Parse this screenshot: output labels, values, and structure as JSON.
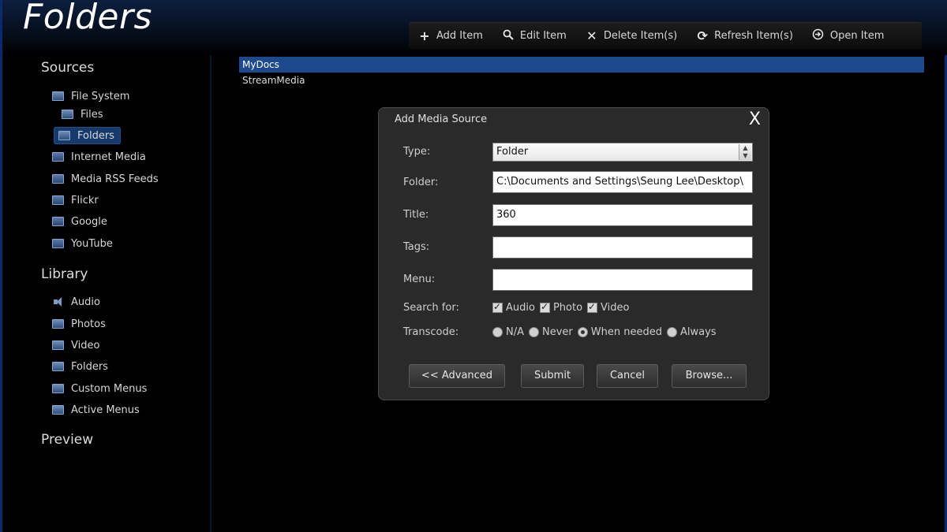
{
  "page": {
    "title": "Folders"
  },
  "toolbar": {
    "add": {
      "icon": "plus-icon",
      "label": "Add Item"
    },
    "edit": {
      "icon": "magnifier-icon",
      "label": "Edit Item"
    },
    "delete": {
      "icon": "x-icon",
      "label": "Delete Item(s)"
    },
    "refresh": {
      "icon": "refresh-icon",
      "label": "Refresh Item(s)"
    },
    "open": {
      "icon": "arrow-circle-icon",
      "label": "Open Item"
    }
  },
  "sidebar": {
    "sources_heading": "Sources",
    "library_heading": "Library",
    "preview_heading": "Preview",
    "sources": [
      {
        "label": "File System"
      },
      {
        "label": "Files"
      },
      {
        "label": "Folders"
      },
      {
        "label": "Internet Media"
      },
      {
        "label": "Media RSS Feeds"
      },
      {
        "label": "Flickr"
      },
      {
        "label": "Google"
      },
      {
        "label": "YouTube"
      }
    ],
    "library": [
      {
        "label": "Audio"
      },
      {
        "label": "Photos"
      },
      {
        "label": "Video"
      },
      {
        "label": "Folders"
      },
      {
        "label": "Custom Menus"
      },
      {
        "label": "Active Menus"
      }
    ]
  },
  "main": {
    "items": [
      {
        "label": "MyDocs",
        "selected": true
      },
      {
        "label": "StreamMedia",
        "selected": false
      }
    ]
  },
  "dialog": {
    "title": "Add Media Source",
    "close_glyph": "X",
    "type_label": "Type:",
    "type_value": "Folder",
    "folder_label": "Folder:",
    "folder_value": "C:\\Documents and Settings\\Seung Lee\\Desktop\\",
    "title_label": "Title:",
    "title_value": "360",
    "tags_label": "Tags:",
    "tags_value": "",
    "menu_label": "Menu:",
    "menu_value": "",
    "search_label": "Search for:",
    "search_options": [
      "Audio",
      "Photo",
      "Video"
    ],
    "transcode_label": "Transcode:",
    "transcode_options": [
      "N/A",
      "Never",
      "When needed",
      "Always"
    ],
    "buttons": {
      "advanced": "<< Advanced",
      "submit": "Submit",
      "cancel": "Cancel",
      "browse": "Browse..."
    }
  },
  "colors": {
    "accent": "#1d4a8c",
    "sidebar_selected": "#173a6c",
    "frame_border": "#0a2a6e",
    "dialog_bg": "#2a2a2a"
  }
}
